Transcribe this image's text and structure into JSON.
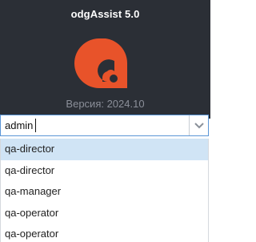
{
  "header": {
    "app_title": "odgAssist 5.0",
    "version_text": "Версия: 2024.10"
  },
  "login": {
    "username_value": "admin",
    "toggle_icon": "chevron-down-icon"
  },
  "dropdown": {
    "options": [
      {
        "label": "qa-director",
        "highlighted": true
      },
      {
        "label": "qa-director",
        "highlighted": false
      },
      {
        "label": "qa-manager",
        "highlighted": false
      },
      {
        "label": "qa-operator",
        "highlighted": false
      },
      {
        "label": "qa-operator",
        "highlighted": false
      }
    ]
  },
  "colors": {
    "header_bg": "#2b2f36",
    "logo_orange": "#e8532a",
    "focus_border": "#5a95d6",
    "highlight_bg": "#d0e4f5"
  }
}
